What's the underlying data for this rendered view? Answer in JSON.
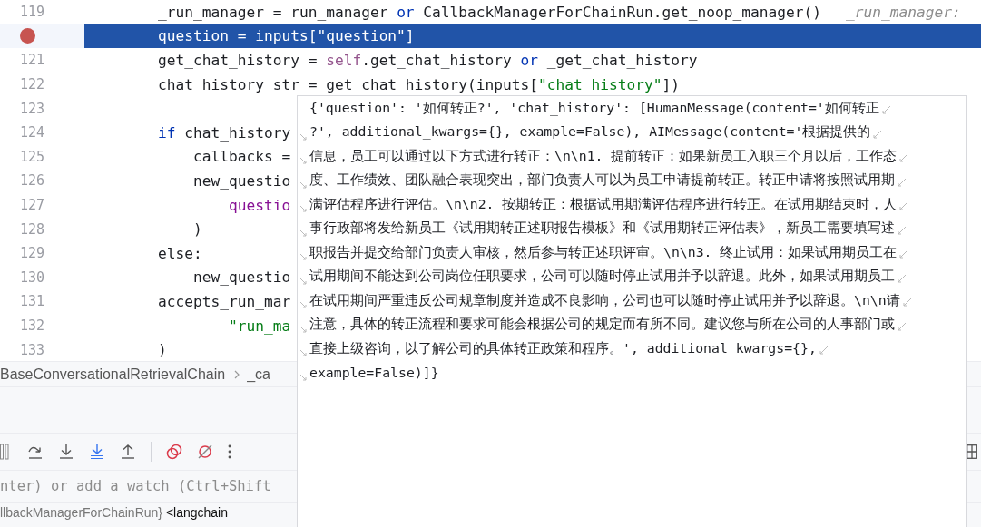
{
  "editor": {
    "lines": [
      {
        "number": "119",
        "breakpoint": false,
        "selected": false,
        "tokens": [
          {
            "kind": "plain",
            "text": "    _run_manager = run_manager "
          },
          {
            "kind": "keyword",
            "text": "or"
          },
          {
            "kind": "plain",
            "text": " CallbackManagerForChainRun.get_noop_manager()"
          },
          {
            "kind": "hint",
            "text": "_run_manager:"
          }
        ]
      },
      {
        "breakpoint": true,
        "selected": true,
        "tokens": [
          {
            "kind": "plain",
            "text": "    question = inputs[\"question\"]"
          }
        ]
      },
      {
        "number": "121",
        "breakpoint": false,
        "selected": false,
        "tokens": [
          {
            "kind": "plain",
            "text": "    get_chat_history = "
          },
          {
            "kind": "self",
            "text": "self"
          },
          {
            "kind": "plain",
            "text": ".get_chat_history "
          },
          {
            "kind": "keyword",
            "text": "or"
          },
          {
            "kind": "plain",
            "text": " _get_chat_history"
          }
        ]
      },
      {
        "number": "122",
        "breakpoint": false,
        "selected": false,
        "tokens": [
          {
            "kind": "plain",
            "text": "    chat_history_str = get_chat_history(inputs["
          },
          {
            "kind": "string",
            "text": "\"chat_history\""
          },
          {
            "kind": "plain",
            "text": "])"
          }
        ]
      },
      {
        "number": "123",
        "breakpoint": false,
        "selected": false
      },
      {
        "number": "124",
        "breakpoint": false,
        "selected": false,
        "tokens": [
          {
            "kind": "keyword",
            "text": "    if"
          },
          {
            "kind": "plain",
            "text": " chat_history"
          }
        ]
      },
      {
        "number": "125",
        "breakpoint": false,
        "selected": false,
        "tokens": [
          {
            "kind": "plain",
            "text": "        callbacks ="
          }
        ]
      },
      {
        "number": "126",
        "breakpoint": false,
        "selected": false,
        "tokens": [
          {
            "kind": "plain",
            "text": "        new_questio"
          }
        ]
      },
      {
        "number": "127",
        "breakpoint": false,
        "selected": false,
        "tokens": [
          {
            "kind": "param",
            "text": "            questio"
          }
        ]
      },
      {
        "number": "128",
        "breakpoint": false,
        "selected": false,
        "tokens": [
          {
            "kind": "plain",
            "text": "        )"
          }
        ]
      },
      {
        "number": "129",
        "breakpoint": false,
        "selected": false,
        "tokens": [
          {
            "kind": "keyword-dark",
            "text": "    else"
          },
          {
            "kind": "plain",
            "text": ":"
          }
        ]
      },
      {
        "number": "130",
        "breakpoint": false,
        "selected": false,
        "tokens": [
          {
            "kind": "plain",
            "text": "        new_questio"
          }
        ]
      },
      {
        "number": "131",
        "breakpoint": false,
        "selected": false,
        "tokens": [
          {
            "kind": "plain",
            "text": "    accepts_run_mar"
          }
        ]
      },
      {
        "number": "132",
        "breakpoint": false,
        "selected": false,
        "tokens": [
          {
            "kind": "string",
            "text": "            \"run_ma"
          }
        ]
      },
      {
        "number": "133",
        "breakpoint": false,
        "selected": false,
        "tokens": [
          {
            "kind": "plain",
            "text": "    )"
          }
        ]
      }
    ]
  },
  "breadcrumb": [
    "BaseConversationalRetrievalChain",
    "_ca"
  ],
  "debug_toolbar": [
    {
      "kind": "pause"
    },
    {
      "kind": "step-over"
    },
    {
      "kind": "step-into"
    },
    {
      "kind": "force-step-into"
    },
    {
      "kind": "step-out"
    },
    {
      "kind": "separator"
    },
    {
      "kind": "view-breakpoints"
    },
    {
      "kind": "mute-breakpoints"
    },
    {
      "kind": "more"
    }
  ],
  "watch_field": {
    "placeholder": "nter) or add a watch (Ctrl+Shift"
  },
  "variables_row": {
    "type_text": "llbackManagerForChainRun}",
    "value_text": "<langchain"
  },
  "popup": {
    "lines": [
      {
        "text": "{'question': '如何转正?', 'chat_history': [HumanMessage(content='如何转正",
        "wraps": true
      },
      {
        "text": "?', additional_kwargs={}, example=False), AIMessage(content='根据提供的",
        "wraps": true
      },
      {
        "text": "信息，员工可以通过以下方式进行转正：\\n\\n1. 提前转正：如果新员工入职三个月以后，工作态",
        "wraps": true
      },
      {
        "text": "度、工作绩效、团队融合表现突出，部门负责人可以为员工申请提前转正。转正申请将按照试用期",
        "wraps": true
      },
      {
        "text": "满评估程序进行评估。\\n\\n2. 按期转正：根据试用期满评估程序进行转正。在试用期结束时，人",
        "wraps": true
      },
      {
        "text": "事行政部将发给新员工《试用期转正述职报告模板》和《试用期转正评估表》，新员工需要填写述",
        "wraps": true
      },
      {
        "text": "职报告并提交给部门负责人审核，然后参与转正述职评审。\\n\\n3. 终止试用：如果试用期员工在",
        "wraps": true
      },
      {
        "text": "试用期间不能达到公司岗位任职要求，公司可以随时停止试用并予以辞退。此外，如果试用期员工",
        "wraps": true
      },
      {
        "text": "在试用期间严重违反公司规章制度并造成不良影响，公司也可以随时停止试用并予以辞退。\\n\\n请",
        "wraps": true
      },
      {
        "text": "注意，具体的转正流程和要求可能会根据公司的规定而有所不同。建议您与所在公司的人事部门或",
        "wraps": true
      },
      {
        "text": "直接上级咨询，以了解公司的具体转正政策和程序。', additional_kwargs={},",
        "wraps": true
      },
      {
        "text": "example=False)]}",
        "wraps": false
      }
    ]
  }
}
